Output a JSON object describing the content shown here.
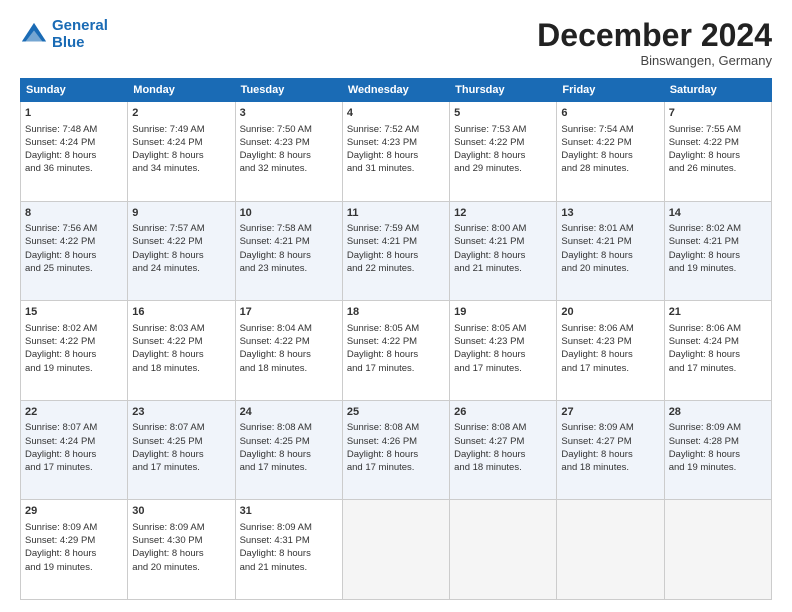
{
  "logo": {
    "line1": "General",
    "line2": "Blue"
  },
  "title": "December 2024",
  "subtitle": "Binswangen, Germany",
  "headers": [
    "Sunday",
    "Monday",
    "Tuesday",
    "Wednesday",
    "Thursday",
    "Friday",
    "Saturday"
  ],
  "weeks": [
    [
      {
        "day": "1",
        "lines": [
          "Sunrise: 7:48 AM",
          "Sunset: 4:24 PM",
          "Daylight: 8 hours",
          "and 36 minutes."
        ]
      },
      {
        "day": "2",
        "lines": [
          "Sunrise: 7:49 AM",
          "Sunset: 4:24 PM",
          "Daylight: 8 hours",
          "and 34 minutes."
        ]
      },
      {
        "day": "3",
        "lines": [
          "Sunrise: 7:50 AM",
          "Sunset: 4:23 PM",
          "Daylight: 8 hours",
          "and 32 minutes."
        ]
      },
      {
        "day": "4",
        "lines": [
          "Sunrise: 7:52 AM",
          "Sunset: 4:23 PM",
          "Daylight: 8 hours",
          "and 31 minutes."
        ]
      },
      {
        "day": "5",
        "lines": [
          "Sunrise: 7:53 AM",
          "Sunset: 4:22 PM",
          "Daylight: 8 hours",
          "and 29 minutes."
        ]
      },
      {
        "day": "6",
        "lines": [
          "Sunrise: 7:54 AM",
          "Sunset: 4:22 PM",
          "Daylight: 8 hours",
          "and 28 minutes."
        ]
      },
      {
        "day": "7",
        "lines": [
          "Sunrise: 7:55 AM",
          "Sunset: 4:22 PM",
          "Daylight: 8 hours",
          "and 26 minutes."
        ]
      }
    ],
    [
      {
        "day": "8",
        "lines": [
          "Sunrise: 7:56 AM",
          "Sunset: 4:22 PM",
          "Daylight: 8 hours",
          "and 25 minutes."
        ]
      },
      {
        "day": "9",
        "lines": [
          "Sunrise: 7:57 AM",
          "Sunset: 4:22 PM",
          "Daylight: 8 hours",
          "and 24 minutes."
        ]
      },
      {
        "day": "10",
        "lines": [
          "Sunrise: 7:58 AM",
          "Sunset: 4:21 PM",
          "Daylight: 8 hours",
          "and 23 minutes."
        ]
      },
      {
        "day": "11",
        "lines": [
          "Sunrise: 7:59 AM",
          "Sunset: 4:21 PM",
          "Daylight: 8 hours",
          "and 22 minutes."
        ]
      },
      {
        "day": "12",
        "lines": [
          "Sunrise: 8:00 AM",
          "Sunset: 4:21 PM",
          "Daylight: 8 hours",
          "and 21 minutes."
        ]
      },
      {
        "day": "13",
        "lines": [
          "Sunrise: 8:01 AM",
          "Sunset: 4:21 PM",
          "Daylight: 8 hours",
          "and 20 minutes."
        ]
      },
      {
        "day": "14",
        "lines": [
          "Sunrise: 8:02 AM",
          "Sunset: 4:21 PM",
          "Daylight: 8 hours",
          "and 19 minutes."
        ]
      }
    ],
    [
      {
        "day": "15",
        "lines": [
          "Sunrise: 8:02 AM",
          "Sunset: 4:22 PM",
          "Daylight: 8 hours",
          "and 19 minutes."
        ]
      },
      {
        "day": "16",
        "lines": [
          "Sunrise: 8:03 AM",
          "Sunset: 4:22 PM",
          "Daylight: 8 hours",
          "and 18 minutes."
        ]
      },
      {
        "day": "17",
        "lines": [
          "Sunrise: 8:04 AM",
          "Sunset: 4:22 PM",
          "Daylight: 8 hours",
          "and 18 minutes."
        ]
      },
      {
        "day": "18",
        "lines": [
          "Sunrise: 8:05 AM",
          "Sunset: 4:22 PM",
          "Daylight: 8 hours",
          "and 17 minutes."
        ]
      },
      {
        "day": "19",
        "lines": [
          "Sunrise: 8:05 AM",
          "Sunset: 4:23 PM",
          "Daylight: 8 hours",
          "and 17 minutes."
        ]
      },
      {
        "day": "20",
        "lines": [
          "Sunrise: 8:06 AM",
          "Sunset: 4:23 PM",
          "Daylight: 8 hours",
          "and 17 minutes."
        ]
      },
      {
        "day": "21",
        "lines": [
          "Sunrise: 8:06 AM",
          "Sunset: 4:24 PM",
          "Daylight: 8 hours",
          "and 17 minutes."
        ]
      }
    ],
    [
      {
        "day": "22",
        "lines": [
          "Sunrise: 8:07 AM",
          "Sunset: 4:24 PM",
          "Daylight: 8 hours",
          "and 17 minutes."
        ]
      },
      {
        "day": "23",
        "lines": [
          "Sunrise: 8:07 AM",
          "Sunset: 4:25 PM",
          "Daylight: 8 hours",
          "and 17 minutes."
        ]
      },
      {
        "day": "24",
        "lines": [
          "Sunrise: 8:08 AM",
          "Sunset: 4:25 PM",
          "Daylight: 8 hours",
          "and 17 minutes."
        ]
      },
      {
        "day": "25",
        "lines": [
          "Sunrise: 8:08 AM",
          "Sunset: 4:26 PM",
          "Daylight: 8 hours",
          "and 17 minutes."
        ]
      },
      {
        "day": "26",
        "lines": [
          "Sunrise: 8:08 AM",
          "Sunset: 4:27 PM",
          "Daylight: 8 hours",
          "and 18 minutes."
        ]
      },
      {
        "day": "27",
        "lines": [
          "Sunrise: 8:09 AM",
          "Sunset: 4:27 PM",
          "Daylight: 8 hours",
          "and 18 minutes."
        ]
      },
      {
        "day": "28",
        "lines": [
          "Sunrise: 8:09 AM",
          "Sunset: 4:28 PM",
          "Daylight: 8 hours",
          "and 19 minutes."
        ]
      }
    ],
    [
      {
        "day": "29",
        "lines": [
          "Sunrise: 8:09 AM",
          "Sunset: 4:29 PM",
          "Daylight: 8 hours",
          "and 19 minutes."
        ]
      },
      {
        "day": "30",
        "lines": [
          "Sunrise: 8:09 AM",
          "Sunset: 4:30 PM",
          "Daylight: 8 hours",
          "and 20 minutes."
        ]
      },
      {
        "day": "31",
        "lines": [
          "Sunrise: 8:09 AM",
          "Sunset: 4:31 PM",
          "Daylight: 8 hours",
          "and 21 minutes."
        ]
      },
      null,
      null,
      null,
      null
    ]
  ]
}
